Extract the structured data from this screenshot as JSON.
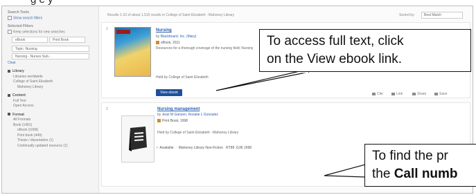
{
  "caption": "g e                                       y",
  "sidebar": {
    "search_tools": "Search Tools",
    "show_search_filters": "Show search filters",
    "selected_filters": "Selected Filters",
    "keep_filters": "Keep selections for new searches",
    "chips": [
      "eBook",
      "Print Book",
      "Topic: Nursing",
      "Nursing - Nurses Sub..."
    ],
    "clear": "Clear",
    "library_head": "Library",
    "library_items": [
      "Libraries worldwide",
      "College of Saint Elizabeth",
      "Mahoney Library"
    ],
    "content_head": "Content",
    "content_items": [
      "Full Text",
      "Open Access"
    ],
    "format_head": "Format",
    "format_items": [
      "All Formats",
      "Book (1491)",
      "eBook (1068)",
      "Print book (449)",
      "Thesis / dissertation (1)",
      "Continually updated resource (1)"
    ]
  },
  "topbar": {
    "results": "Results  1-10 of about 1,515 results in College of Saint Elizabeth - Mahoney Library",
    "sort_label": "Sorted by:",
    "sort_value": "Best Match"
  },
  "record1": {
    "num": "1",
    "title": "Nursing",
    "author_prefix": "by",
    "author": "Blackboard, Inc. (Mary)",
    "format": "eBook, 2011",
    "desc": "Resources for a thorough coverage of the nursing field; Nursing theory, basic procedures and outcomes.",
    "held": "Held by College of Saint Elizabeth",
    "button": "View ebook",
    "actions": [
      "Cite",
      "Link",
      "Share",
      "Save"
    ]
  },
  "record2": {
    "num": "2",
    "title": "Nursing management",
    "author_prefix": "by",
    "author": "Jean M Ganzen, Rosalie L Gonzalez",
    "format": "Print Book, 1998",
    "held": "Held by College of Saint Elizabeth - Mahoney Library",
    "availability": "Available",
    "location": "Mahoney Library Non-Fiction",
    "callnumber": "RT89 .G36 1998"
  },
  "callouts": {
    "c1_line1": "To access  full text, click",
    "c1_line2": "on the View ebook link.",
    "c2_line1": "To find the pr",
    "c2_line2_prefix": "the ",
    "c2_line2_bold": "Call numb"
  }
}
